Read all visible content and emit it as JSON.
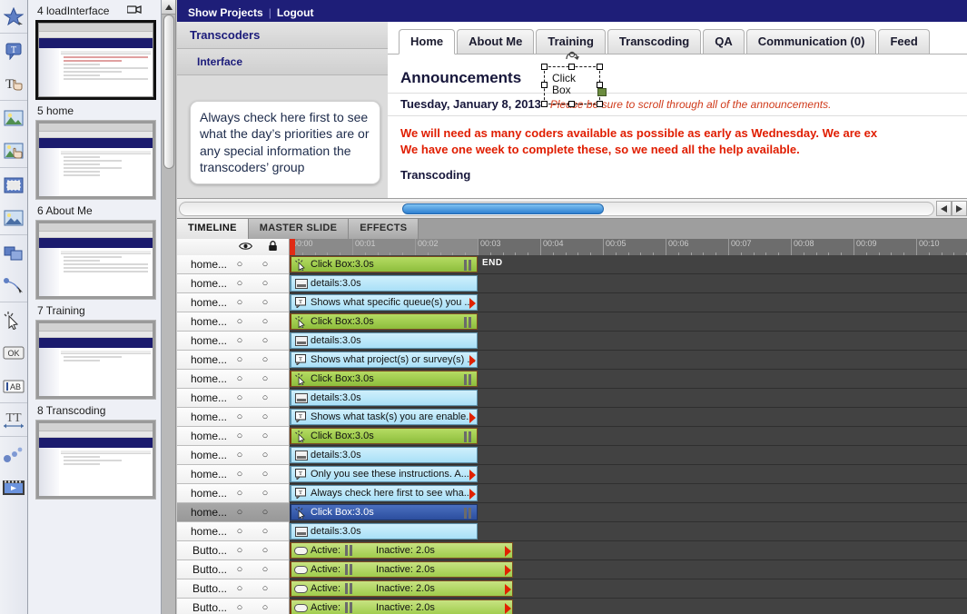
{
  "toolbar": {
    "items": [
      {
        "name": "smart-shape-icon",
        "label": "Smart Shape"
      },
      {
        "name": "text-caption-icon",
        "label": "Text Caption"
      },
      {
        "name": "rollover-caption-icon",
        "label": "Rollover Caption"
      },
      {
        "name": "image-icon",
        "label": "Image"
      },
      {
        "name": "rollover-image-icon",
        "label": "Rollover Image"
      },
      {
        "name": "highlight-box-icon",
        "label": "Highlight Box"
      },
      {
        "name": "rollover-slidelet-icon",
        "label": "Rollover Slidelet"
      },
      {
        "name": "zoom-area-icon",
        "label": "Zoom Area"
      },
      {
        "name": "mouse-path-icon",
        "label": "Mouse"
      },
      {
        "name": "click-box-icon",
        "label": "Click Box"
      },
      {
        "name": "button-icon",
        "label": "OK"
      },
      {
        "name": "text-entry-box-icon",
        "label": "AB"
      },
      {
        "name": "text-animation-icon",
        "label": "Text Animation"
      },
      {
        "name": "animation-icon",
        "label": "Animation"
      },
      {
        "name": "video-icon",
        "label": "Video"
      }
    ]
  },
  "filmstrip": {
    "slides": [
      {
        "number": "4",
        "title": "loadInterface",
        "label": "4 loadInterface",
        "has_video_icon": true,
        "selected": true
      },
      {
        "number": "5",
        "title": "home",
        "label": "5 home",
        "has_video_icon": false,
        "selected": false
      },
      {
        "number": "6",
        "title": "About Me",
        "label": "6 About Me",
        "has_video_icon": false,
        "selected": false
      },
      {
        "number": "7",
        "title": "Training",
        "label": "7 Training",
        "has_video_icon": false,
        "selected": false
      },
      {
        "number": "8",
        "title": "Transcoding",
        "label": "8 Transcoding",
        "has_video_icon": false,
        "selected": false
      }
    ]
  },
  "preview": {
    "topbar": {
      "show_projects": "Show Projects",
      "separator": "|",
      "logout": "Logout"
    },
    "sidebar": {
      "section_title": "Transcoders",
      "sub_title": "Interface",
      "callout_text": "Always check here first to see what the day’s priorities are or any special information the transcoders’ group"
    },
    "tabs": [
      {
        "label": "Home",
        "active": true
      },
      {
        "label": "About Me",
        "active": false
      },
      {
        "label": "Training",
        "active": false
      },
      {
        "label": "Transcoding",
        "active": false
      },
      {
        "label": "QA",
        "active": false
      },
      {
        "label": "Communication (0)",
        "active": false
      },
      {
        "label": "Feed",
        "active": false
      }
    ],
    "announcements_title": "Announcements",
    "announcement_date": "Tuesday, January 8, 2013",
    "announcement_note": "Please be sure to scroll through all of the announcements.",
    "announcement_line1": "We will need as many coders available as possible as early as Wednesday. We are ex",
    "announcement_line2": "We have one week to complete these, so we need all the help available.",
    "section_heading": "Transcoding",
    "clickbox_label_line1": "Click",
    "clickbox_label_line2": "Box"
  },
  "timeline": {
    "tabs": [
      {
        "label": "TIMELINE",
        "active": true
      },
      {
        "label": "MASTER SLIDE",
        "active": false
      },
      {
        "label": "EFFECTS",
        "active": false
      }
    ],
    "header_icons": [
      {
        "name": "eye-icon",
        "label": "Show/Hide"
      },
      {
        "name": "lock-icon",
        "label": "Lock"
      }
    ],
    "ruler_ticks": [
      "00:00",
      "00:01",
      "00:02",
      "00:03",
      "00:04",
      "00:05",
      "00:06",
      "00:07",
      "00:08",
      "00:09",
      "00:10"
    ],
    "end_label": "END",
    "rows": [
      {
        "name": "home...",
        "bar": "Click Box:3.0s",
        "type": "clickbox",
        "icon": "click-box-icon",
        "selected": false
      },
      {
        "name": "home...",
        "bar": "details:3.0s",
        "type": "caption",
        "icon": "caption-icon",
        "selected": false
      },
      {
        "name": "home...",
        "bar": "Shows what specific queue(s) you ...",
        "type": "text",
        "icon": "text-caption-icon",
        "selected": false
      },
      {
        "name": "home...",
        "bar": "Click Box:3.0s",
        "type": "clickbox",
        "icon": "click-box-icon",
        "selected": false
      },
      {
        "name": "home...",
        "bar": "details:3.0s",
        "type": "caption",
        "icon": "caption-icon",
        "selected": false
      },
      {
        "name": "home...",
        "bar": "Shows what project(s) or survey(s) ...",
        "type": "text",
        "icon": "text-caption-icon",
        "selected": false
      },
      {
        "name": "home...",
        "bar": "Click Box:3.0s",
        "type": "clickbox",
        "icon": "click-box-icon",
        "selected": false
      },
      {
        "name": "home...",
        "bar": "details:3.0s",
        "type": "caption",
        "icon": "caption-icon",
        "selected": false
      },
      {
        "name": "home...",
        "bar": "Shows what task(s) you are enable...",
        "type": "text",
        "icon": "text-caption-icon",
        "selected": false
      },
      {
        "name": "home...",
        "bar": "Click Box:3.0s",
        "type": "clickbox",
        "icon": "click-box-icon",
        "selected": false
      },
      {
        "name": "home...",
        "bar": "details:3.0s",
        "type": "caption",
        "icon": "caption-icon",
        "selected": false
      },
      {
        "name": "home...",
        "bar": "Only you see these instructions. A...",
        "type": "text",
        "icon": "text-caption-icon",
        "selected": false
      },
      {
        "name": "home...",
        "bar": "Always check here first to see wha...",
        "type": "text",
        "icon": "text-caption-icon",
        "selected": false
      },
      {
        "name": "home...",
        "bar": "Click Box:3.0s",
        "type": "clickbox",
        "icon": "click-box-icon",
        "selected": true
      },
      {
        "name": "home...",
        "bar": "details:3.0s",
        "type": "caption",
        "icon": "caption-icon",
        "selected": false
      },
      {
        "name": "Butto...",
        "bar": "Active:",
        "bar2": "Inactive: 2.0s",
        "type": "button",
        "icon": "button-icon",
        "selected": false
      },
      {
        "name": "Butto...",
        "bar": "Active:",
        "bar2": "Inactive: 2.0s",
        "type": "button",
        "icon": "button-icon",
        "selected": false
      },
      {
        "name": "Butto...",
        "bar": "Active:",
        "bar2": "Inactive: 2.0s",
        "type": "button",
        "icon": "button-icon",
        "selected": false
      },
      {
        "name": "Butto...",
        "bar": "Active:",
        "bar2": "Inactive: 2.0s",
        "type": "button",
        "icon": "button-icon",
        "selected": false
      }
    ]
  },
  "colors": {
    "nav_blue": "#1e1e78",
    "accent_red": "#e01d00",
    "bar_green": "#8dbd3c",
    "bar_blue": "#a9e0f7",
    "bar_selected": "#2c4e9e",
    "playhead": "#e02b16"
  }
}
